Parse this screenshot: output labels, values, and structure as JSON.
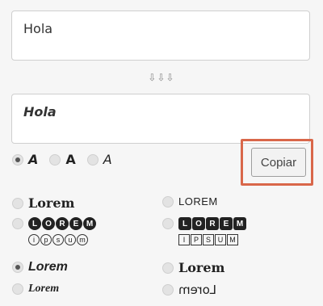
{
  "input": {
    "value": "Hola"
  },
  "arrows": "⇩⇩⇩",
  "output": {
    "value": "Hola"
  },
  "styles": [
    {
      "label": "A",
      "checked": true
    },
    {
      "label": "A",
      "checked": false
    },
    {
      "label": "A",
      "checked": false
    }
  ],
  "copy_button": "Copiar",
  "options": {
    "left": {
      "o1": "Lorem",
      "o2_top": [
        "L",
        "O",
        "R",
        "E",
        "M"
      ],
      "o2_bottom": [
        "i",
        "p",
        "s",
        "u",
        "m"
      ],
      "o3": "Lorem",
      "o4": "Lorem"
    },
    "right": {
      "o1": "LOREM",
      "o2_top": [
        "L",
        "O",
        "R",
        "E",
        "M"
      ],
      "o2_bottom": [
        "I",
        "P",
        "S",
        "U",
        "M"
      ],
      "o3": "Lorem",
      "o4": "Lorem"
    }
  },
  "colors": {
    "highlight": "#d9674a",
    "background": "#f6f6f6"
  }
}
